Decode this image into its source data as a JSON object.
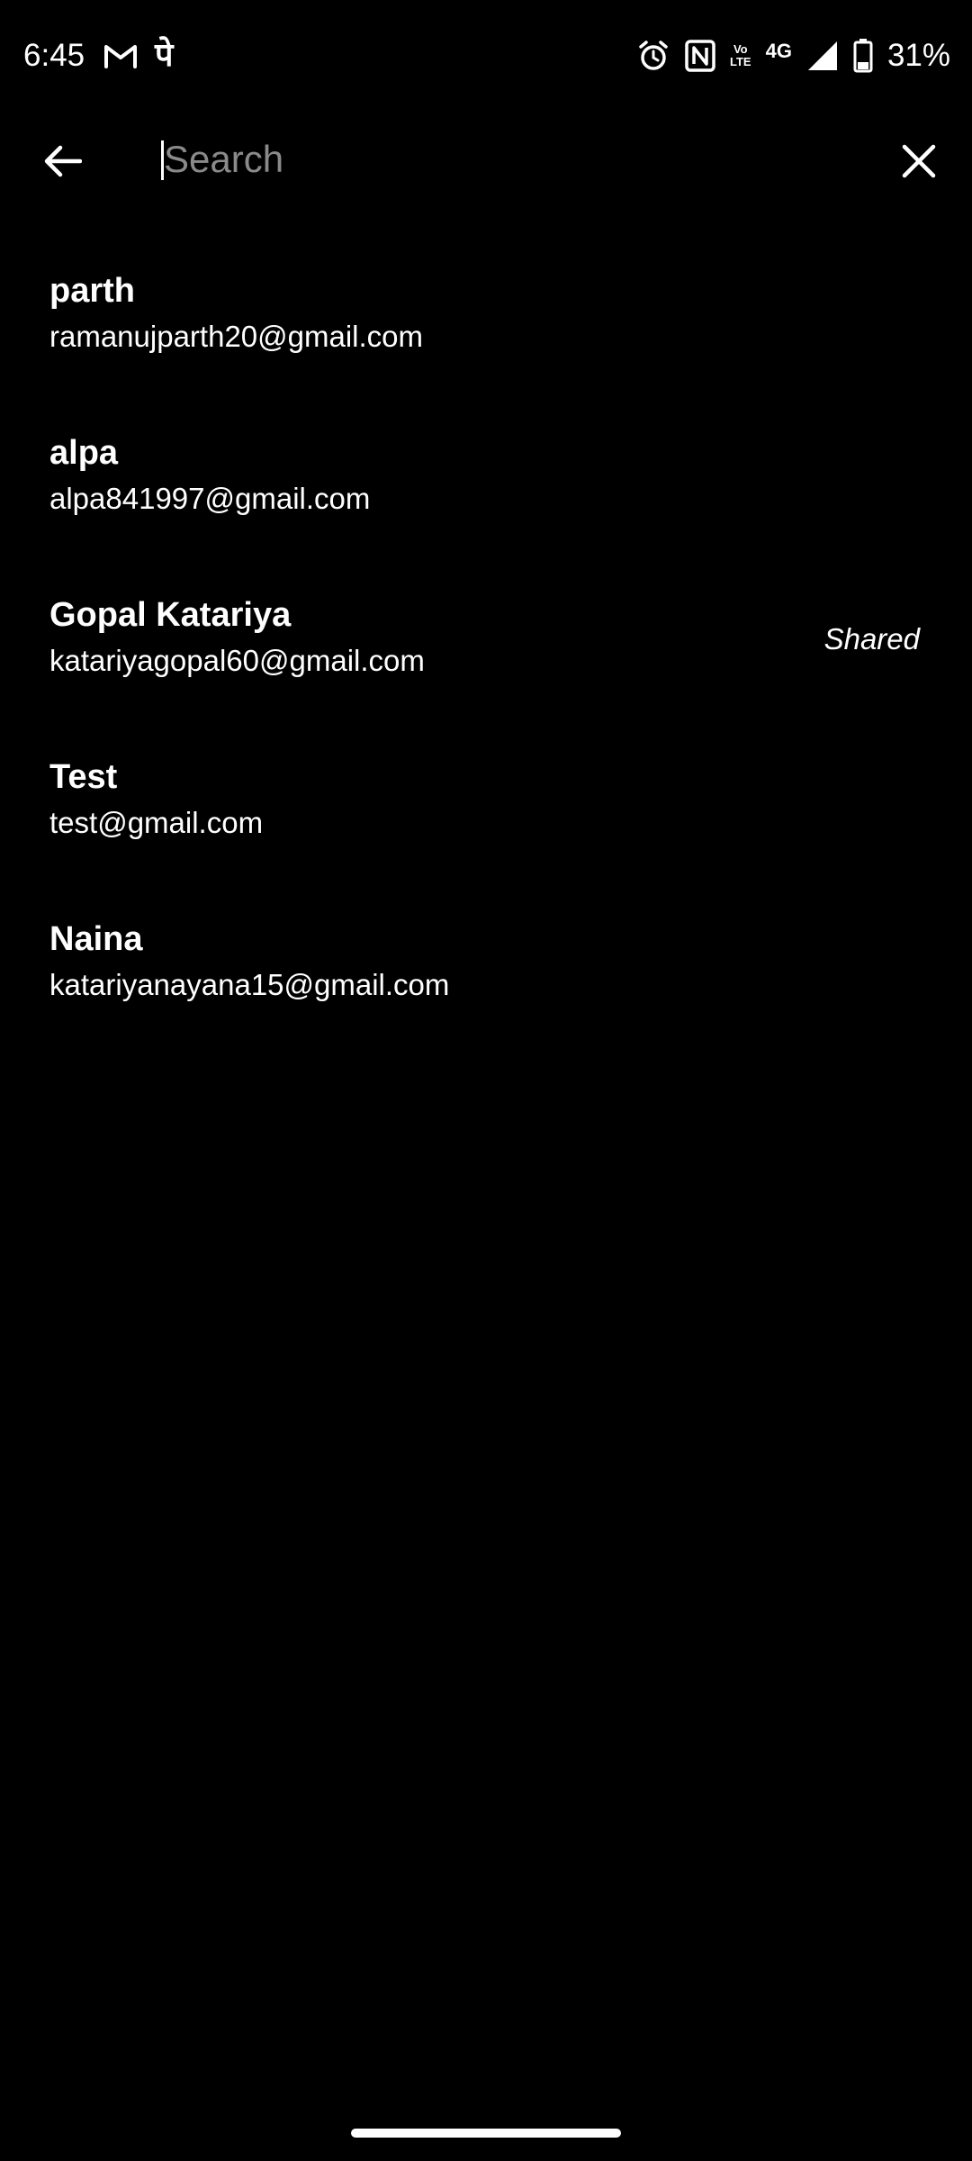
{
  "status_bar": {
    "time": "6:45",
    "battery_percent": "31%",
    "network": "4G",
    "volte_top": "Vo",
    "volte_bottom": "LTE",
    "left_icons": [
      "gmail-icon",
      "phonepe-icon"
    ],
    "right_icons": [
      "alarm-icon",
      "nfc-icon",
      "volte-icon",
      "signal-icon",
      "battery-icon"
    ],
    "phonepe_glyph": "पे"
  },
  "search": {
    "placeholder": "Search",
    "value": ""
  },
  "contacts": [
    {
      "name": "parth",
      "email": "ramanujparth20@gmail.com",
      "status": ""
    },
    {
      "name": "alpa",
      "email": "alpa841997@gmail.com",
      "status": ""
    },
    {
      "name": "Gopal Katariya",
      "email": "katariyagopal60@gmail.com",
      "status": "Shared"
    },
    {
      "name": "Test",
      "email": "test@gmail.com",
      "status": ""
    },
    {
      "name": "Naina",
      "email": "katariyanayana15@gmail.com",
      "status": ""
    }
  ],
  "colors": {
    "background": "#000000",
    "text": "#ffffff",
    "placeholder": "#8a8a8a"
  }
}
